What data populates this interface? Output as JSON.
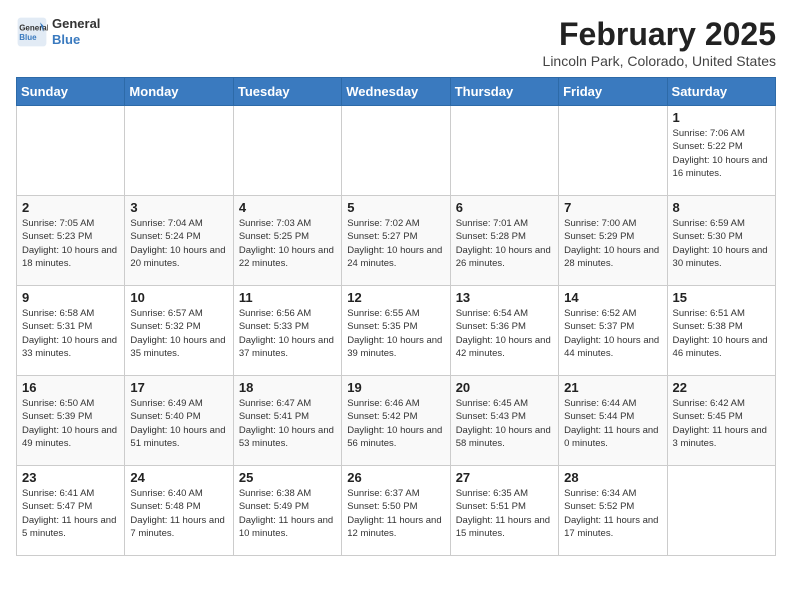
{
  "header": {
    "logo": {
      "general": "General",
      "blue": "Blue"
    },
    "title": "February 2025",
    "location": "Lincoln Park, Colorado, United States"
  },
  "weekdays": [
    "Sunday",
    "Monday",
    "Tuesday",
    "Wednesday",
    "Thursday",
    "Friday",
    "Saturday"
  ],
  "weeks": [
    [
      {
        "day": "",
        "info": ""
      },
      {
        "day": "",
        "info": ""
      },
      {
        "day": "",
        "info": ""
      },
      {
        "day": "",
        "info": ""
      },
      {
        "day": "",
        "info": ""
      },
      {
        "day": "",
        "info": ""
      },
      {
        "day": "1",
        "info": "Sunrise: 7:06 AM\nSunset: 5:22 PM\nDaylight: 10 hours and 16 minutes."
      }
    ],
    [
      {
        "day": "2",
        "info": "Sunrise: 7:05 AM\nSunset: 5:23 PM\nDaylight: 10 hours and 18 minutes."
      },
      {
        "day": "3",
        "info": "Sunrise: 7:04 AM\nSunset: 5:24 PM\nDaylight: 10 hours and 20 minutes."
      },
      {
        "day": "4",
        "info": "Sunrise: 7:03 AM\nSunset: 5:25 PM\nDaylight: 10 hours and 22 minutes."
      },
      {
        "day": "5",
        "info": "Sunrise: 7:02 AM\nSunset: 5:27 PM\nDaylight: 10 hours and 24 minutes."
      },
      {
        "day": "6",
        "info": "Sunrise: 7:01 AM\nSunset: 5:28 PM\nDaylight: 10 hours and 26 minutes."
      },
      {
        "day": "7",
        "info": "Sunrise: 7:00 AM\nSunset: 5:29 PM\nDaylight: 10 hours and 28 minutes."
      },
      {
        "day": "8",
        "info": "Sunrise: 6:59 AM\nSunset: 5:30 PM\nDaylight: 10 hours and 30 minutes."
      }
    ],
    [
      {
        "day": "9",
        "info": "Sunrise: 6:58 AM\nSunset: 5:31 PM\nDaylight: 10 hours and 33 minutes."
      },
      {
        "day": "10",
        "info": "Sunrise: 6:57 AM\nSunset: 5:32 PM\nDaylight: 10 hours and 35 minutes."
      },
      {
        "day": "11",
        "info": "Sunrise: 6:56 AM\nSunset: 5:33 PM\nDaylight: 10 hours and 37 minutes."
      },
      {
        "day": "12",
        "info": "Sunrise: 6:55 AM\nSunset: 5:35 PM\nDaylight: 10 hours and 39 minutes."
      },
      {
        "day": "13",
        "info": "Sunrise: 6:54 AM\nSunset: 5:36 PM\nDaylight: 10 hours and 42 minutes."
      },
      {
        "day": "14",
        "info": "Sunrise: 6:52 AM\nSunset: 5:37 PM\nDaylight: 10 hours and 44 minutes."
      },
      {
        "day": "15",
        "info": "Sunrise: 6:51 AM\nSunset: 5:38 PM\nDaylight: 10 hours and 46 minutes."
      }
    ],
    [
      {
        "day": "16",
        "info": "Sunrise: 6:50 AM\nSunset: 5:39 PM\nDaylight: 10 hours and 49 minutes."
      },
      {
        "day": "17",
        "info": "Sunrise: 6:49 AM\nSunset: 5:40 PM\nDaylight: 10 hours and 51 minutes."
      },
      {
        "day": "18",
        "info": "Sunrise: 6:47 AM\nSunset: 5:41 PM\nDaylight: 10 hours and 53 minutes."
      },
      {
        "day": "19",
        "info": "Sunrise: 6:46 AM\nSunset: 5:42 PM\nDaylight: 10 hours and 56 minutes."
      },
      {
        "day": "20",
        "info": "Sunrise: 6:45 AM\nSunset: 5:43 PM\nDaylight: 10 hours and 58 minutes."
      },
      {
        "day": "21",
        "info": "Sunrise: 6:44 AM\nSunset: 5:44 PM\nDaylight: 11 hours and 0 minutes."
      },
      {
        "day": "22",
        "info": "Sunrise: 6:42 AM\nSunset: 5:45 PM\nDaylight: 11 hours and 3 minutes."
      }
    ],
    [
      {
        "day": "23",
        "info": "Sunrise: 6:41 AM\nSunset: 5:47 PM\nDaylight: 11 hours and 5 minutes."
      },
      {
        "day": "24",
        "info": "Sunrise: 6:40 AM\nSunset: 5:48 PM\nDaylight: 11 hours and 7 minutes."
      },
      {
        "day": "25",
        "info": "Sunrise: 6:38 AM\nSunset: 5:49 PM\nDaylight: 11 hours and 10 minutes."
      },
      {
        "day": "26",
        "info": "Sunrise: 6:37 AM\nSunset: 5:50 PM\nDaylight: 11 hours and 12 minutes."
      },
      {
        "day": "27",
        "info": "Sunrise: 6:35 AM\nSunset: 5:51 PM\nDaylight: 11 hours and 15 minutes."
      },
      {
        "day": "28",
        "info": "Sunrise: 6:34 AM\nSunset: 5:52 PM\nDaylight: 11 hours and 17 minutes."
      },
      {
        "day": "",
        "info": ""
      }
    ]
  ]
}
